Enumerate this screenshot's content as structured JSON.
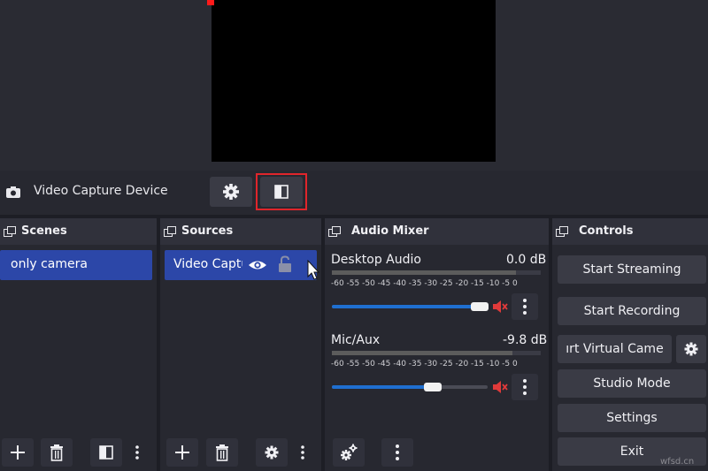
{
  "source_toolbar": {
    "source_name": "Video Capture Device"
  },
  "scenes": {
    "title": "Scenes",
    "items": [
      "only camera"
    ]
  },
  "sources": {
    "title": "Sources",
    "items": [
      "Video Captu"
    ]
  },
  "mixer": {
    "title": "Audio Mixer",
    "ticks": "-60  -55  -50  -45  -40  -35  -30  -25  -20  -15  -10   -5    0",
    "channels": [
      {
        "name": "Desktop Audio",
        "db": "0.0 dB",
        "volume": 0.95
      },
      {
        "name": "Mic/Aux",
        "db": "-9.8 dB",
        "volume": 0.65
      }
    ]
  },
  "controls": {
    "title": "Controls",
    "start_streaming": "Start Streaming",
    "start_recording": "Start Recording",
    "virtual_camera": "ırt Virtual Came",
    "studio_mode": "Studio Mode",
    "settings": "Settings",
    "exit": "Exit"
  },
  "watermark": "wfsd.cn",
  "colors": {
    "accent": "#2c47a8",
    "highlight": "#e0252b",
    "mute": "#e03a3a",
    "slider": "#1f6fd0"
  }
}
